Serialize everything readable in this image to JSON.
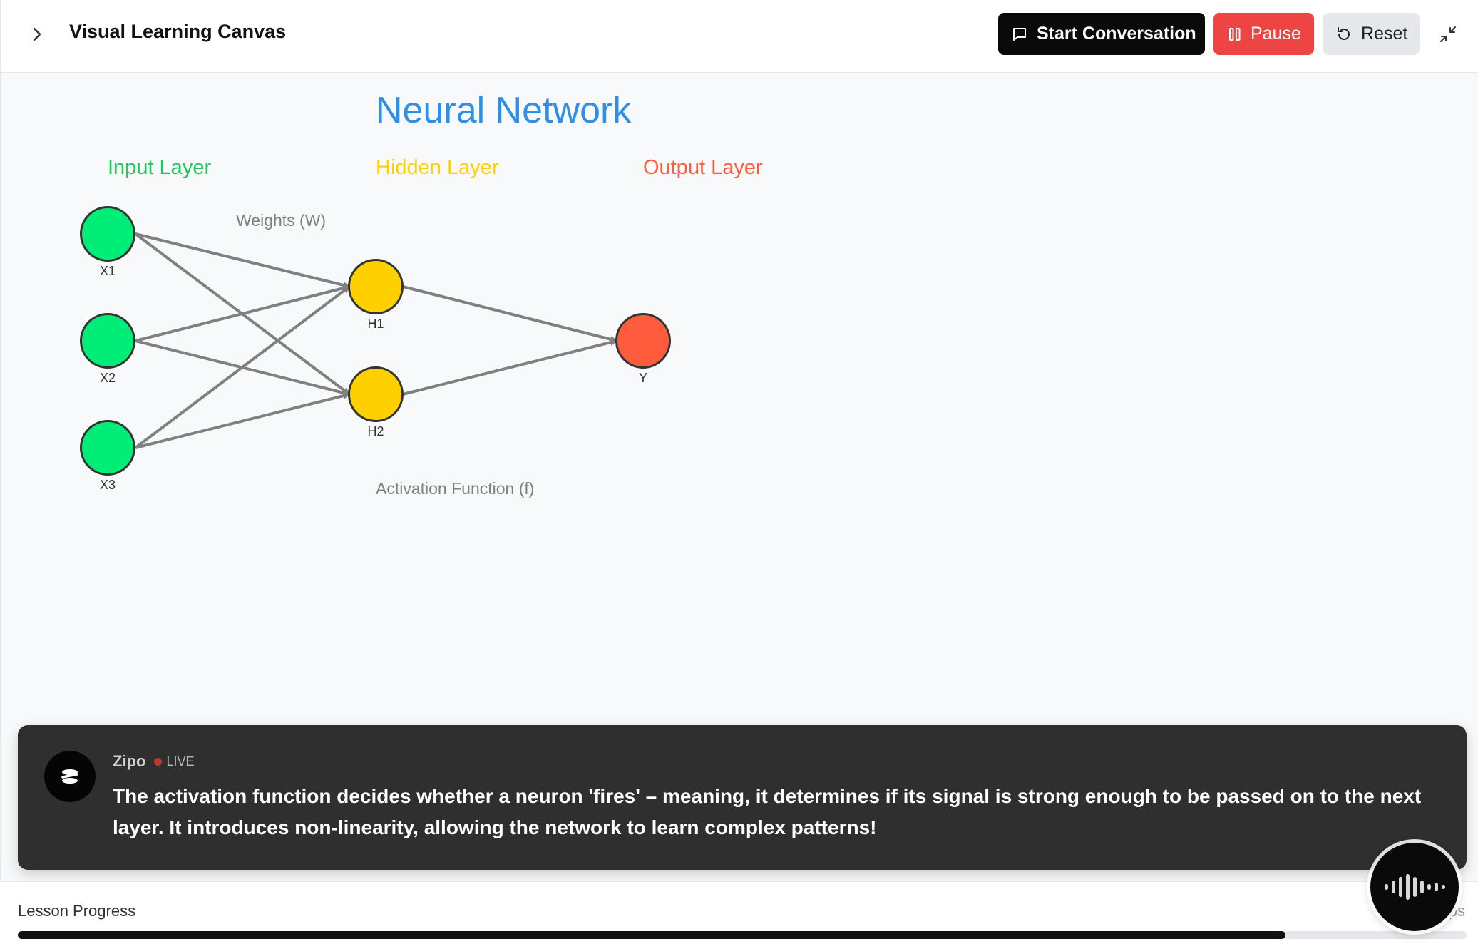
{
  "header": {
    "title": "Visual Learning Canvas",
    "start_label": "Start Conversation",
    "pause_label": "Pause",
    "reset_label": "Reset"
  },
  "diagram": {
    "title": "Neural Network",
    "layers": {
      "input": "Input Layer",
      "hidden": "Hidden Layer",
      "output": "Output Layer"
    },
    "weights_label": "Weights (W)",
    "activation_label": "Activation Function (f)",
    "nodes": {
      "x1": "X1",
      "x2": "X2",
      "x3": "X3",
      "h1": "H1",
      "h2": "H2",
      "y": "Y"
    },
    "colors": {
      "title": "#2e8fe8",
      "input": "#22c55e",
      "input_fill": "#00ee77",
      "hidden": "#ffd000",
      "output": "#ff5c3d",
      "edge": "#808080"
    }
  },
  "narration": {
    "speaker": "Zipo",
    "live": "LIVE",
    "text": "The activation function decides whether a neuron 'fires' – meaning, it determines if its signal is strong enough to be passed on to the next layer. It introduces non-linearity, allowing the network to learn complex patterns!"
  },
  "progress": {
    "label": "Lesson Progress",
    "steps_text": "2 … ps",
    "fraction": 0.875
  }
}
